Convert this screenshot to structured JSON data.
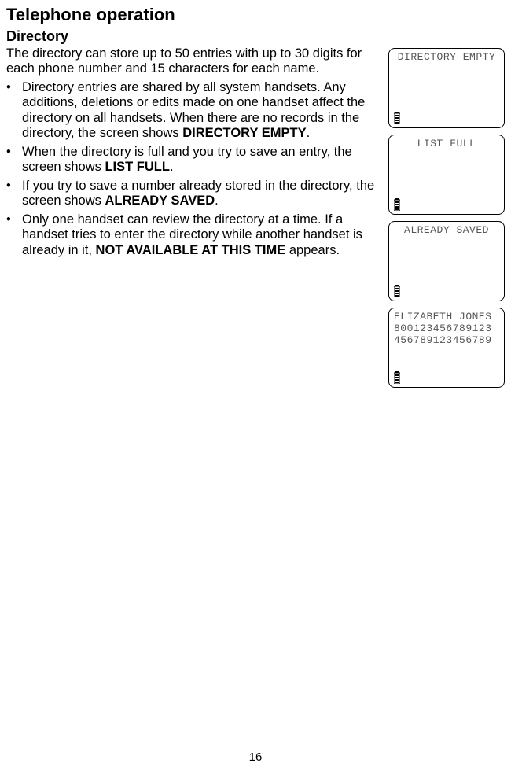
{
  "page_title": "Telephone operation",
  "section_title": "Directory",
  "intro_text": "The directory can store up to 50 entries with up to 30 digits for each phone number and 15 characters for each name.",
  "bullets": [
    {
      "pre": "Directory entries are shared by all system handsets. Any additions, deletions or edits made on one handset affect the directory on all handsets. When there are no records in the directory, the screen shows ",
      "bold": "DIRECTORY EMPTY",
      "post": "."
    },
    {
      "pre": "When the directory is full and you try to save an entry, the screen shows ",
      "bold": "LIST FULL",
      "post": "."
    },
    {
      "pre": "If you try to save a number already stored in the directory, the screen shows ",
      "bold": "ALREADY SAVED",
      "post": "."
    },
    {
      "pre": "Only one handset can review the directory at a time. If a handset tries to enter the directory while another handset is already in it, ",
      "bold": "NOT AVAILABLE AT THIS TIME",
      "post": " appears."
    }
  ],
  "screens": [
    {
      "lines": [
        "DIRECTORY EMPTY"
      ],
      "align": "center"
    },
    {
      "lines": [
        "LIST FULL"
      ],
      "align": "center"
    },
    {
      "lines": [
        "ALREADY SAVED"
      ],
      "align": "center"
    },
    {
      "lines": [
        "ELIZABETH JONES",
        "800123456789123",
        "456789123456789"
      ],
      "align": "left"
    }
  ],
  "page_number": "16"
}
